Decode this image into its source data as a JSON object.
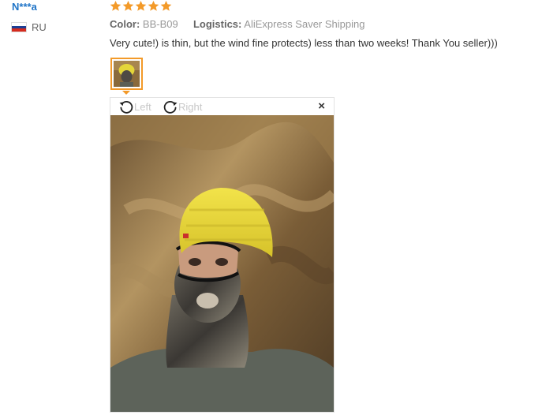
{
  "review": {
    "user_name": "N***a",
    "country_code": "RU",
    "rating": 5,
    "color_label": "Color:",
    "color_value": "BB-B09",
    "logistics_label": "Logistics:",
    "logistics_value": "AliExpress Saver Shipping",
    "text": "Very cute!) is thin, but the wind fine protects) less than two weeks! Thank You seller)))"
  },
  "viewer": {
    "rotate_left_label": "Left",
    "rotate_right_label": "Right",
    "close_label": "×"
  },
  "icons": {
    "star": "star-icon",
    "rotate_left": "rotate-left-icon",
    "rotate_right": "rotate-right-icon",
    "close": "close-icon",
    "flag": "russia-flag-icon"
  },
  "colors": {
    "star": "#f39a29",
    "user_link": "#1f74c7",
    "thumb_border": "#f39a29"
  }
}
